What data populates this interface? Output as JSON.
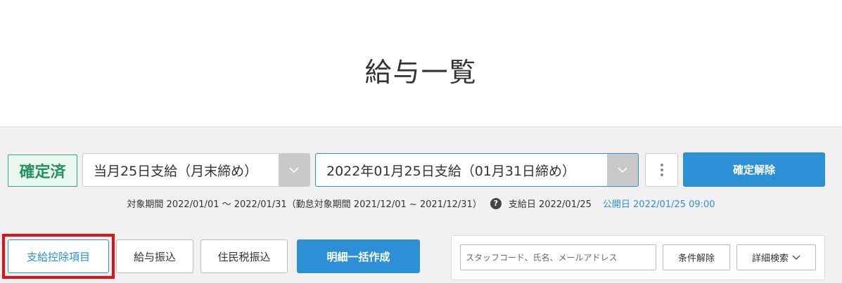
{
  "page": {
    "title": "給与一覧"
  },
  "status": {
    "label": "確定済",
    "color": "#26915f"
  },
  "selectors": {
    "payment_type": {
      "value": "当月25日支給（月末締め）",
      "icon": "chevron-down-icon"
    },
    "payment_date": {
      "value": "2022年01月25日支給（01月31日締め）",
      "icon": "chevron-down-icon"
    }
  },
  "actions": {
    "more_icon": "kebab-menu-icon",
    "unconfirm_label": "確定解除"
  },
  "info": {
    "period": "対象期間 2022/01/01 〜 2022/01/31（勤怠対象期間 2021/12/01 ~ 2021/12/31）",
    "help_icon": "?",
    "pay_date": "支給日 2022/01/25",
    "publish_date": "公開日 2022/01/25 09:00"
  },
  "toolbar": {
    "items_label": "支給控除項目",
    "transfer_label": "給与振込",
    "resident_tax_label": "住民税振込",
    "bulk_create_label": "明細一括作成"
  },
  "search": {
    "placeholder": "スタッフコード、氏名、メールアドレス",
    "clear_label": "条件解除",
    "detail_label": "詳細検索"
  },
  "colors": {
    "accent": "#2d8fd5",
    "highlight": "#e3101a",
    "status_bg": "#eaf7f0"
  }
}
